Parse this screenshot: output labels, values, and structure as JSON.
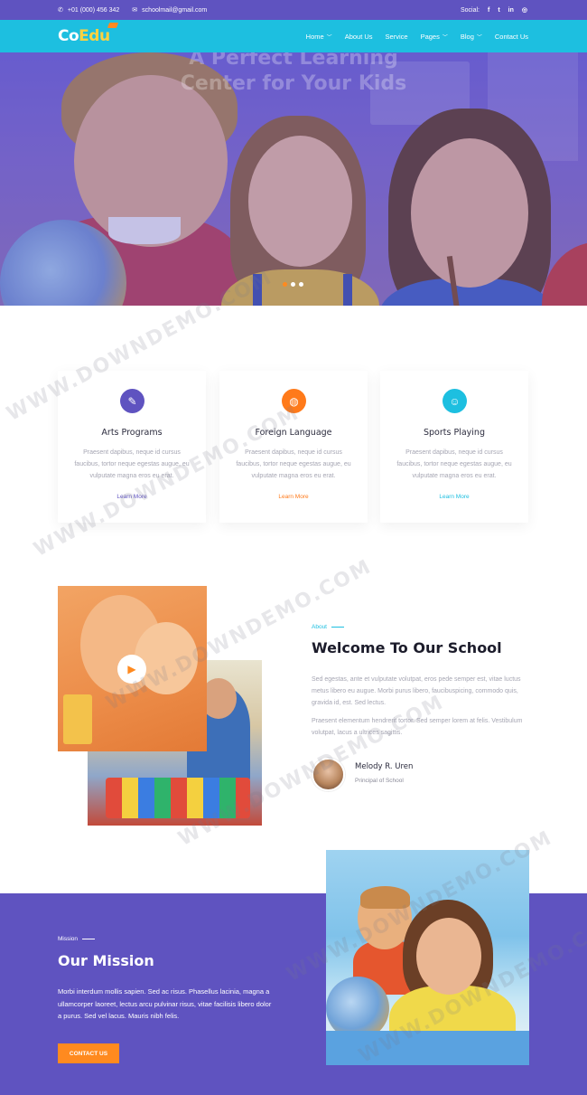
{
  "topbar": {
    "phone": "+01 (000) 456 342",
    "email": "schoolmail@gmail.com",
    "social_label": "Social:",
    "social_icons": [
      "facebook-icon",
      "twitter-icon",
      "linkedin-icon",
      "instagram-icon"
    ]
  },
  "nav": {
    "logo_part1": "Co",
    "logo_part2": "Edu",
    "menu": [
      "Home",
      "About Us",
      "Service",
      "Pages",
      "Blog",
      "Contact Us"
    ],
    "dropdown_items": [
      "Home",
      "Pages",
      "Blog"
    ]
  },
  "hero": {
    "title_line1": "A Perfect Learning",
    "title_line2": "Center for Your Kids",
    "slides": 3,
    "active_slide": 1
  },
  "features": [
    {
      "title": "Arts Programs",
      "text": "Praesent dapibus, neque id cursus faucibus, tortor neque egestas augue, eu vulputate magna eros eu erat.",
      "link": "Learn More",
      "color": "#5f53c0",
      "icon": "palette-icon"
    },
    {
      "title": "Foreign Language",
      "text": "Praesent dapibus, neque id cursus faucibus, tortor neque egestas augue, eu vulputate magna eros eu erat.",
      "link": "Learn More",
      "color": "#ff7a1a",
      "icon": "globe-icon"
    },
    {
      "title": "Sports Playing",
      "text": "Praesent dapibus, neque id cursus faucibus, tortor neque egestas augue, eu vulputate magna eros eu erat.",
      "link": "Learn More",
      "color": "#1dbfe0",
      "icon": "sports-icon"
    }
  ],
  "about": {
    "tag": "About",
    "title": "Welcome To Our School",
    "p1": "Sed egestas, ante et vulputate volutpat, eros pede semper est, vitae luctus metus libero eu augue. Morbi purus libero, faucibuspicing, commodo quis, gravida id, est. Sed lectus.",
    "p2": "Praesent elementum hendrerit tortor. Sed semper lorem at felis. Vestibulum volutpat, lacus a ultrices sagittis.",
    "principal_name": "Melody R. Uren",
    "principal_role": "Principal of School"
  },
  "mission": {
    "tag": "Mission",
    "title": "Our Mission",
    "text": "Morbi interdum mollis sapien. Sed ac risus. Phasellus lacinia, magna a ullamcorper laoreet, lectus arcu pulvinar risus, vitae facilisis libero dolor a purus. Sed vel lacus. Mauris nibh felis.",
    "button": "CONTACT US"
  },
  "watermark": "WWW.DOWNDEMO.COM",
  "colors": {
    "primary": "#5f53c0",
    "accent": "#1dbfe0",
    "orange": "#ff8a1f"
  }
}
